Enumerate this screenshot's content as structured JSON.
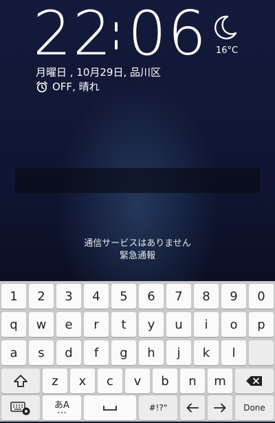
{
  "lockscreen": {
    "clock_hour": "22",
    "clock_minute": "06",
    "temperature": "16°C",
    "weather_icon": "moon-icon",
    "date": "月曜日 , 10月29日, 品川区",
    "alarm_icon": "alarm-clock-icon",
    "alarm_weather": "OFF, 晴れ",
    "no_service": "通信サービスはありません",
    "emergency_call": "緊急通報"
  },
  "keyboard": {
    "number_row": [
      "1",
      "2",
      "3",
      "4",
      "5",
      "6",
      "7",
      "8",
      "9",
      "0"
    ],
    "row1": [
      "q",
      "w",
      "e",
      "r",
      "t",
      "y",
      "u",
      "i",
      "o",
      "p"
    ],
    "row2": [
      "a",
      "s",
      "d",
      "f",
      "g",
      "h",
      "j",
      "k",
      "l"
    ],
    "row3": [
      "z",
      "x",
      "c",
      "v",
      "b",
      "n",
      "m"
    ],
    "lang_key": "あA",
    "symbols_key": "#!?\"",
    "done_key": "Done",
    "icons": {
      "shift": "shift-icon",
      "backspace": "backspace-icon",
      "keyboard_settings": "keyboard-settings-icon",
      "space": "space-icon",
      "left": "arrow-left-icon",
      "right": "arrow-right-icon"
    }
  }
}
